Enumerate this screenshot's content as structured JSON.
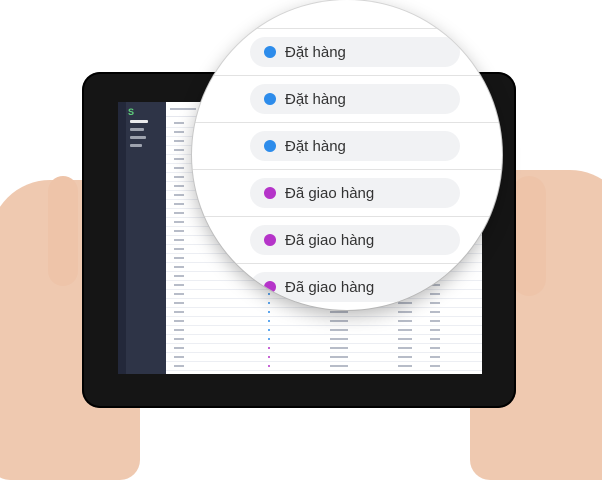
{
  "colors": {
    "blue_status": "#2d8ceb",
    "purple_status": "#b534c9",
    "sidebar": "#2e3447",
    "tablet_frame": "#151515"
  },
  "zoom_statuses": [
    {
      "label": "Đặt hàng",
      "color": "#2d8ceb"
    },
    {
      "label": "Đặt hàng",
      "color": "#2d8ceb"
    },
    {
      "label": "Đặt hàng",
      "color": "#2d8ceb"
    },
    {
      "label": "Đã giao hàng",
      "color": "#b534c9"
    },
    {
      "label": "Đã giao hàng",
      "color": "#b534c9"
    },
    {
      "label": "Đã giao hàng",
      "color": "#b534c9"
    }
  ],
  "icons": {
    "logo": "s-logo-icon"
  }
}
